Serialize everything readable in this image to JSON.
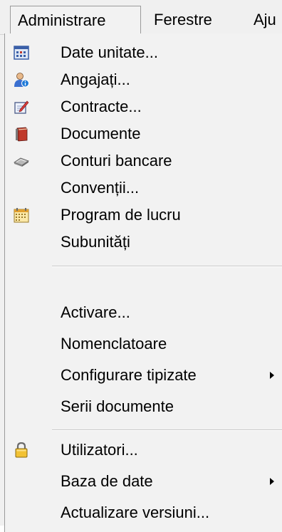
{
  "menubar": {
    "items": [
      {
        "label": "Administrare"
      },
      {
        "label": "Ferestre"
      },
      {
        "label": "Aju"
      }
    ]
  },
  "menu": {
    "items": [
      {
        "label": "Date unitate...",
        "icon": "unit-data-icon"
      },
      {
        "label": "Angajați...",
        "icon": "employees-icon"
      },
      {
        "label": "Contracte...",
        "icon": "contracts-icon"
      },
      {
        "label": "Documente",
        "icon": "documents-icon"
      },
      {
        "label": "Conturi bancare",
        "icon": "bank-accounts-icon"
      },
      {
        "label": "Convenții...",
        "icon": ""
      },
      {
        "label": "Program de lucru",
        "icon": "calendar-icon"
      },
      {
        "label": "Subunități",
        "icon": ""
      },
      {
        "label": "Activare...",
        "icon": ""
      },
      {
        "label": "Nomenclatoare",
        "icon": ""
      },
      {
        "label": "Configurare tipizate",
        "icon": "",
        "submenu": true
      },
      {
        "label": "Serii documente",
        "icon": ""
      },
      {
        "label": "Utilizatori...",
        "icon": "lock-icon"
      },
      {
        "label": "Baza de date",
        "icon": "",
        "submenu": true
      },
      {
        "label": "Actualizare versiuni...",
        "icon": ""
      }
    ]
  }
}
